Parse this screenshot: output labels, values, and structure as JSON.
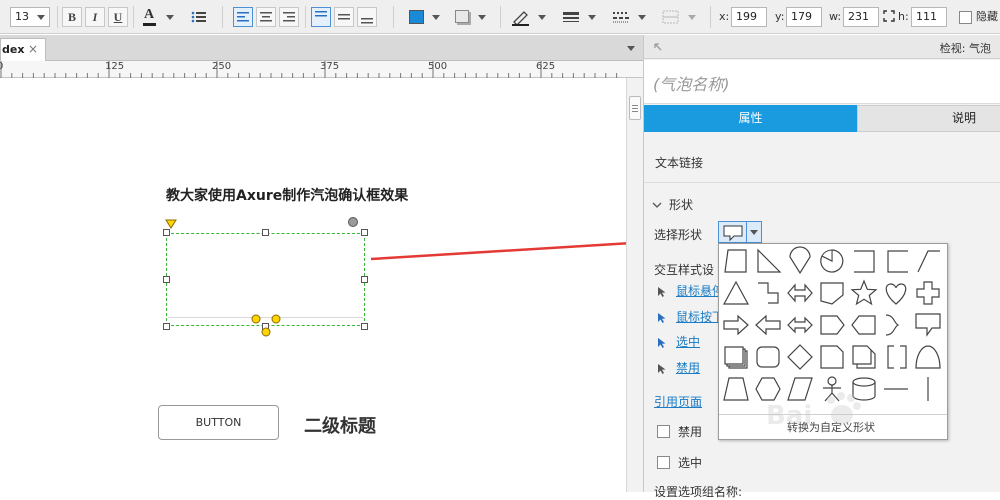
{
  "toolbar": {
    "font_size": "13",
    "bold": "B",
    "italic": "I",
    "underline": "U",
    "font_color": "A",
    "x_label": "x:",
    "x_value": "199",
    "y_label": "y:",
    "y_value": "179",
    "w_label": "w:",
    "w_value": "231",
    "h_label": "h:",
    "h_value": "111",
    "hidden_label": "隐藏"
  },
  "tabs": {
    "doc_tab_label": "dex",
    "close_glyph": "×"
  },
  "ruler": {
    "marks": [
      "0",
      "125",
      "250",
      "375",
      "500",
      "625"
    ]
  },
  "canvas": {
    "heading": "教大家使用Axure制作汽泡确认框效果",
    "button_label": "BUTTON",
    "subheading": "二级标题"
  },
  "right_panel": {
    "header": "检视: 气泡",
    "element_name": "(气泡名称)",
    "tab_properties": "属性",
    "tab_notes": "说明",
    "text_link": "文本链接",
    "shape_section": "形状",
    "select_shape": "选择形状",
    "interaction_styles": "交互样式设",
    "mouse_hover": "鼠标悬停",
    "mouse_down": "鼠标按下",
    "selected": "选中",
    "disabled": "禁用",
    "reference_page": "引用页面",
    "disabled_checkbox": "禁用",
    "selected_checkbox": "选中",
    "option_group": "设置选项组名称:"
  },
  "shape_popup": {
    "convert_label": "转换为自定义形状",
    "shapes": [
      "trapezoid-shape",
      "right-triangle-shape",
      "teardrop-shape",
      "pie-shape",
      "rectangle-shape",
      "bracket-rect-shape",
      "slanted-corner-shape",
      "triangle-shape",
      "step-shape",
      "double-arrow-shape",
      "pentagon-tag-shape",
      "star-shape",
      "heart-shape",
      "cross-shape",
      "right-arrow-shape",
      "left-arrow-shape",
      "left-right-arrow-shape",
      "arrow-tag-shape",
      "reverse-tag-shape",
      "brace-shape",
      "callout-shape",
      "stack-shape",
      "rounded-rect-shape",
      "diamond-shape",
      "document-shape",
      "multi-document-shape",
      "bracket-left-shape",
      "semicircle-shape",
      "trapezoid-inverse-shape",
      "hexagon-shape",
      "parallelogram-shape",
      "actor-shape",
      "database-shape",
      "horizontal-line-shape",
      "vertical-line-shape"
    ]
  },
  "colors": {
    "accent": "#1a9be0",
    "arrow": "#e53935",
    "selection": "#38b638",
    "handle_yellow": "#ffd400"
  }
}
